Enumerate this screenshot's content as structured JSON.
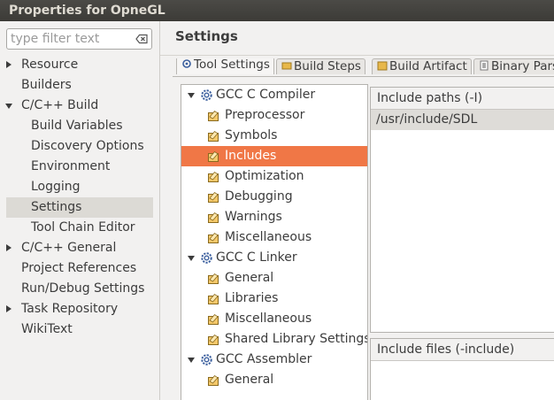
{
  "window": {
    "title": "Properties for OpneGL"
  },
  "filter": {
    "placeholder": "type filter text"
  },
  "nav": {
    "items": [
      {
        "label": "Resource",
        "arrow": "collapsed"
      },
      {
        "label": "Builders",
        "arrow": "none"
      },
      {
        "label": "C/C++ Build",
        "arrow": "expanded"
      },
      {
        "label": "Build Variables",
        "arrow": "child"
      },
      {
        "label": "Discovery Options",
        "arrow": "child"
      },
      {
        "label": "Environment",
        "arrow": "child"
      },
      {
        "label": "Logging",
        "arrow": "child"
      },
      {
        "label": "Settings",
        "arrow": "child",
        "selected": true
      },
      {
        "label": "Tool Chain Editor",
        "arrow": "child"
      },
      {
        "label": "C/C++ General",
        "arrow": "collapsed"
      },
      {
        "label": "Project References",
        "arrow": "none"
      },
      {
        "label": "Run/Debug Settings",
        "arrow": "none"
      },
      {
        "label": "Task Repository",
        "arrow": "collapsed"
      },
      {
        "label": "WikiText",
        "arrow": "none"
      }
    ]
  },
  "page": {
    "title": "Settings"
  },
  "tabs": [
    {
      "label": "Tool Settings",
      "active": true
    },
    {
      "label": "Build Steps"
    },
    {
      "label": "Build Artifact"
    },
    {
      "label": "Binary Parsers"
    }
  ],
  "tree": {
    "nodes": [
      {
        "label": "GCC C Compiler",
        "kind": "tool"
      },
      {
        "label": "Preprocessor",
        "kind": "option"
      },
      {
        "label": "Symbols",
        "kind": "option"
      },
      {
        "label": "Includes",
        "kind": "option",
        "selected": true
      },
      {
        "label": "Optimization",
        "kind": "option"
      },
      {
        "label": "Debugging",
        "kind": "option"
      },
      {
        "label": "Warnings",
        "kind": "option"
      },
      {
        "label": "Miscellaneous",
        "kind": "option"
      },
      {
        "label": "GCC C Linker",
        "kind": "tool"
      },
      {
        "label": "General",
        "kind": "option"
      },
      {
        "label": "Libraries",
        "kind": "option"
      },
      {
        "label": "Miscellaneous",
        "kind": "option"
      },
      {
        "label": "Shared Library Settings",
        "kind": "option"
      },
      {
        "label": "GCC Assembler",
        "kind": "tool"
      },
      {
        "label": "General",
        "kind": "option"
      }
    ]
  },
  "include_paths": {
    "header": "Include paths (-I)",
    "values": [
      "/usr/include/SDL"
    ]
  },
  "include_files": {
    "header": "Include files (-include)",
    "values": []
  },
  "colors": {
    "selection": "#f07746",
    "title_bar": "#3c3b37",
    "nav_selection": "#dcdad5"
  },
  "icons": {
    "tool": "gear-icon",
    "option": "option-page-icon",
    "filter_clear": "clear-icon"
  }
}
